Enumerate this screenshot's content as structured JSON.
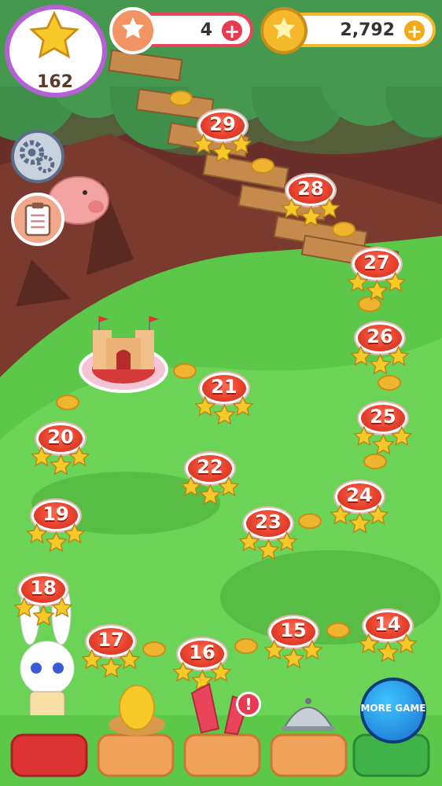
{
  "hud": {
    "star_total": "162",
    "lives": "4",
    "coins": "2,792",
    "plus": "+"
  },
  "levels": [
    {
      "label": "29"
    },
    {
      "label": "28"
    },
    {
      "label": "27"
    },
    {
      "label": "26"
    },
    {
      "label": "25"
    },
    {
      "label": "24"
    },
    {
      "label": "23"
    },
    {
      "label": "22"
    },
    {
      "label": "21"
    },
    {
      "label": "20"
    },
    {
      "label": "19"
    },
    {
      "label": "18"
    },
    {
      "label": "17"
    },
    {
      "label": "16"
    },
    {
      "label": "15"
    },
    {
      "label": "14"
    }
  ],
  "bottom_bar": {
    "more_game_label": "MORE GAME",
    "alert_mark": "!"
  },
  "colors": {
    "sky_brown": "#6a2f2a",
    "grass": "#5cc84a",
    "level_red": "#e8422e",
    "star_yellow": "#f7c928",
    "hud_red": "#e8455c",
    "hud_gold": "#f4b82a"
  },
  "icons": [
    "star-icon",
    "heart-life-icon",
    "coin-icon",
    "gear-icon",
    "clipboard-icon",
    "piggy-bank-icon",
    "egg-nest-icon",
    "rocket-icon",
    "food-cloche-icon"
  ]
}
